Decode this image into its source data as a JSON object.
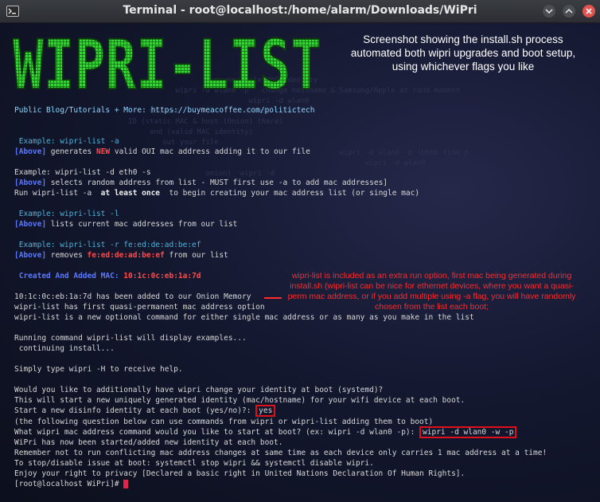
{
  "window": {
    "title": "Terminal - root@localhost:/home/alarm/Downloads/WiPri"
  },
  "banner": {
    "logo_text": "WIPRI-LIST"
  },
  "annotations": {
    "top_note": "Screenshot showing the install.sh process automated both wipri upgrades and boot setup, using whichever flags you like",
    "side_note": "wipri-list is included as an extra run option, first mac being generated during install.sh (wipri-list can be nice for ethernet devices, where you want a quasi-perm mac address, or if you add multiple using -a flag, you will have randomly chosen from the list each boot;"
  },
  "terminal": {
    "blog": "Public Blog/Tutorials + More: https://buymeacoffee.com/politictech",
    "ex1_cmd": " Example: wipri-list -a",
    "ex1_tag": "[Above]",
    "ex1_a": " generates ",
    "ex1_new": "NEW",
    "ex1_b": " valid OUI mac address adding it to our file",
    "ex2_cmd": "Example: wipri-list -d eth0 -s",
    "ex2_tag": "[Above]",
    "ex2_text": " selects random address from list - MUST first use -a to add mac addresses]",
    "ex2_run_a": "Run wipri-list -a  ",
    "ex2_run_bold": "at least once",
    "ex2_run_b": "  to begin creating your mac address list (or single mac)",
    "ex3_cmd": " Example: wipri-list -l",
    "ex3_tag": "[Above]",
    "ex3_text": " lists current mac addresses from our list",
    "ex4_cmd": " Example: wipri-list -r fe:ed:de:ad:be:ef",
    "ex4_tag": "[Above]",
    "ex4_a": " removes ",
    "ex4_mac": "fe:ed:de:ad:be:ef",
    "ex4_b": " from our list",
    "created_label": " Created And Added MAC:",
    "created_mac": " 10:1c:0c:eb:1a:7d",
    "line_memory": "10:1c:0c:eb:1a:7d has been added to our Onion Memory",
    "line_first": "wipri-list has first quasi-permanent mac address option",
    "line_optional": "wipri-list is a new optional command for either single mac address or as many as you make in the list",
    "line_running": "Running command wipri-list will display examples...",
    "line_continue": " continuing install...",
    "line_simply": "Simply type wipri -H to receive help.",
    "line_q1": "Would you like to additionally have wipri change your identity at boot (systemd)?",
    "line_q2": "This will start a new uniquely generated identity (mac/hostname) for your wifi device at each boot.",
    "line_q3": "Start a new disinfo identity at each boot (yes/no)?: ",
    "answer_yes": "yes",
    "line_q4": "(the following question below can use commands from wipri or wipri-list adding them to boot)",
    "line_q5": "What wipri mac address command would you like to start at boot? (ex: wipri -d wlan0 -p): ",
    "answer_cmd": "wipri -d wlan0 -w -p",
    "line_started": "WiPri has now been started/added new identity at each boot.",
    "line_remember": "Remember not to run conflicting mac address changes at same time as each device only carries 1 mac address at a time!",
    "line_stop": "To stop/disable issue at boot: systemctl stop wipri && systemctl disable wipri.",
    "line_enjoy": "Enjoy your right to privacy [Declared a basic right in United Nations Declaration Of Human Rights].",
    "prompt": "[root@localhost WiPri]# "
  }
}
